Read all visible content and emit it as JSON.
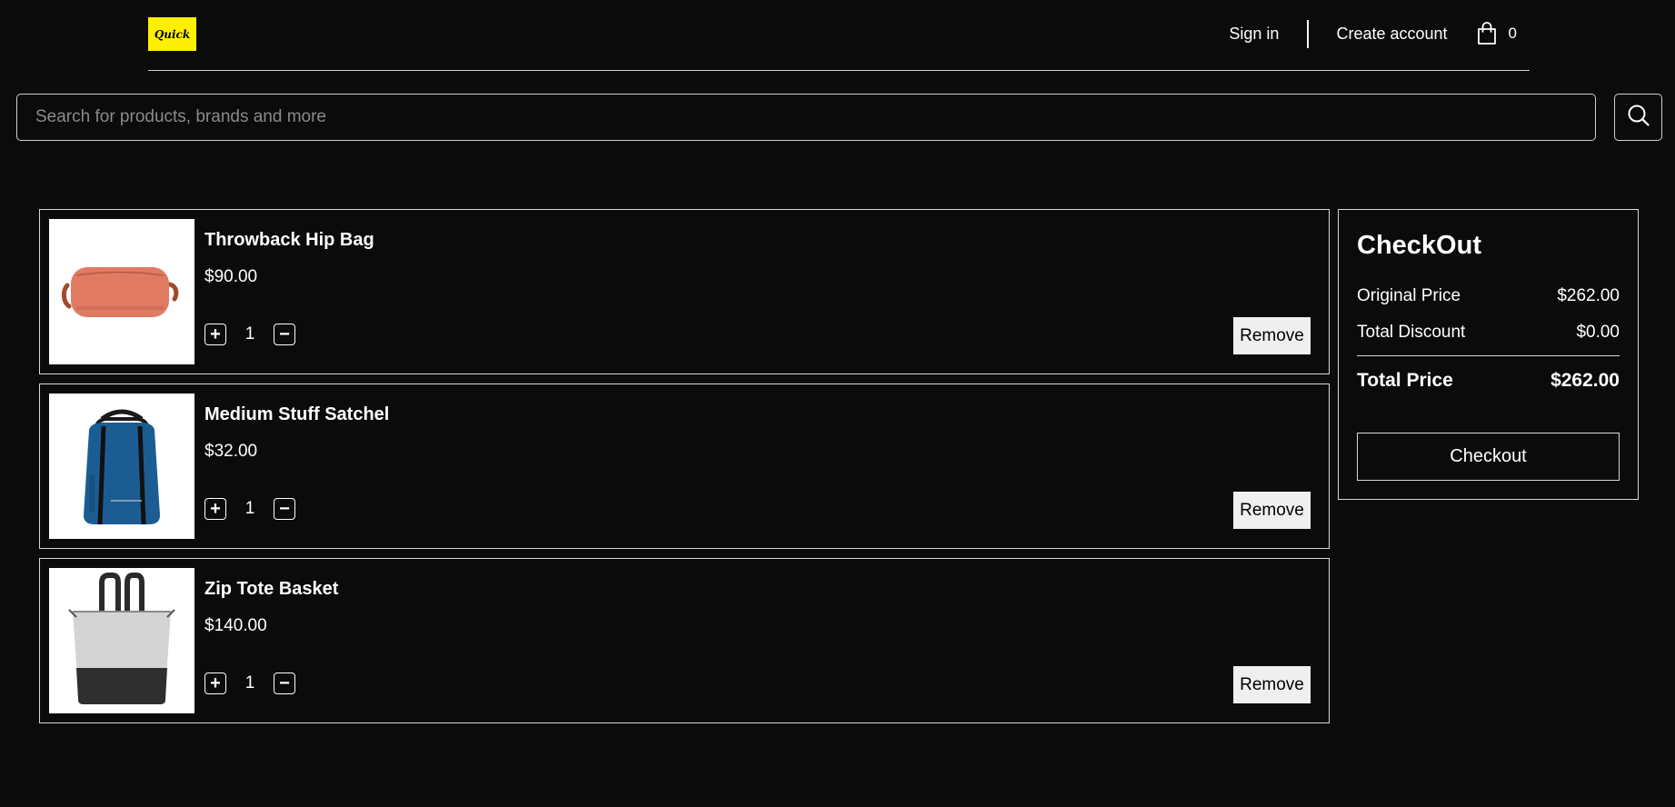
{
  "header": {
    "logo_text": "Quick",
    "sign_in": "Sign in",
    "create_account": "Create account",
    "cart_count": "0"
  },
  "search": {
    "placeholder": "Search for products, brands and more"
  },
  "cart_items": [
    {
      "name": "Throwback Hip Bag",
      "price": "$90.00",
      "quantity": "1",
      "remove_label": "Remove",
      "increase_label": "+",
      "decrease_label": "−"
    },
    {
      "name": "Medium Stuff Satchel",
      "price": "$32.00",
      "quantity": "1",
      "remove_label": "Remove",
      "increase_label": "+",
      "decrease_label": "−"
    },
    {
      "name": "Zip Tote Basket",
      "price": "$140.00",
      "quantity": "1",
      "remove_label": "Remove",
      "increase_label": "+",
      "decrease_label": "−"
    }
  ],
  "checkout": {
    "title": "CheckOut",
    "original_price_label": "Original Price",
    "original_price": "$262.00",
    "discount_label": "Total Discount",
    "discount": "$0.00",
    "total_label": "Total Price",
    "total": "$262.00",
    "button_label": "Checkout"
  },
  "colors": {
    "background": "#0b0b0b",
    "logo": "#ffef00",
    "hip_bag": "#e07a63",
    "satchel": "#1b5d93",
    "tote_light": "#d4d4d4",
    "tote_dark": "#2f2f2f"
  }
}
